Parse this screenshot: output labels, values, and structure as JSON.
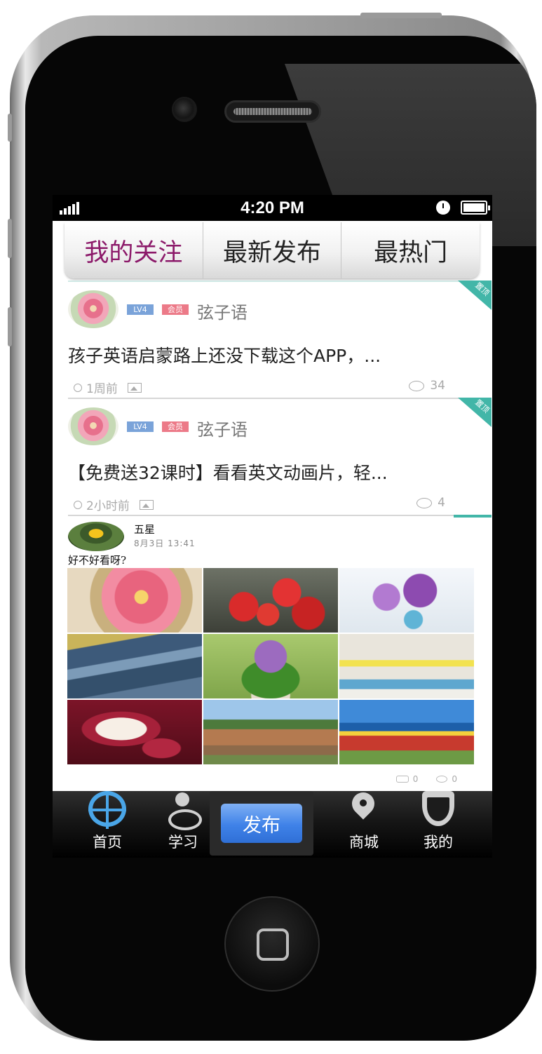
{
  "status_bar": {
    "time": "4:20 PM"
  },
  "tabs": [
    {
      "label": "我的关注",
      "active": true
    },
    {
      "label": "最新发布",
      "active": false
    },
    {
      "label": "最热门",
      "active": false
    }
  ],
  "posts": [
    {
      "level": "LV4",
      "member": "会员",
      "username": "弦子语",
      "title": "孩子英语启蒙路上还没下载这个APP，...",
      "time": "1周前",
      "comments": "34",
      "pinned": "置顶"
    },
    {
      "level": "LV4",
      "member": "会员",
      "username": "弦子语",
      "title": "【免费送32课时】看看英文动画片，轻...",
      "time": "2小时前",
      "comments": "4",
      "pinned": "置顶"
    }
  ],
  "photo_post": {
    "username": "五星",
    "date": "8月3日 13:41",
    "text": "好不好看呀?",
    "likes": "0",
    "comments": "0",
    "photos": [
      "pink-gerbera-flower",
      "strawberries",
      "purple-flowers-in-vases",
      "rocky-river",
      "potted-purple-flowers",
      "colorful-room",
      "red-velvet-cake",
      "stone-monastery",
      "chinese-memorial-hall"
    ]
  },
  "tabbar": {
    "home": "首页",
    "study": "学习",
    "publish": "发布",
    "shop": "商城",
    "me": "我的"
  },
  "colors": {
    "active_tab": "#8c1a6a",
    "accent_teal": "#42b6a8",
    "home_icon": "#4aa6e8",
    "publish_button": "#3f82e8"
  }
}
